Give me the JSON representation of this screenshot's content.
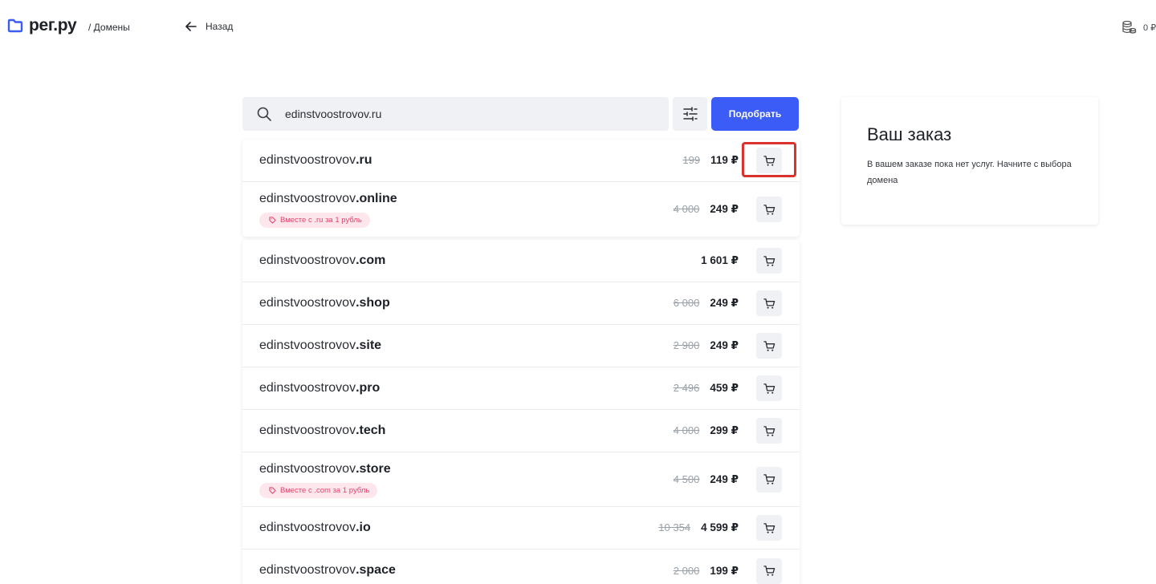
{
  "header": {
    "logo_text": "рег.ру",
    "section": "/ Домены",
    "back_label": "Назад",
    "balance": "0 ₽",
    "accent": "#3b5cf6"
  },
  "search": {
    "value": "edinstvoostrovov.ru",
    "placeholder": "",
    "submit_label": "Подобрать"
  },
  "icons": {
    "logo": "folder-icon",
    "back": "arrow-left-icon",
    "balance": "coins-icon",
    "search": "search-icon",
    "filter": "sliders-icon",
    "cart": "cart-icon",
    "promo": "tag-icon"
  },
  "domains": [
    {
      "name": "edinstvoostrovov",
      "tld": ".ru",
      "old_price": "199",
      "price": "119 ₽",
      "promo": ""
    },
    {
      "name": "edinstvoostrovov",
      "tld": ".online",
      "old_price": "4 000",
      "price": "249 ₽",
      "promo": "Вместе с .ru за 1 рубль"
    },
    {
      "name": "edinstvoostrovov",
      "tld": ".com",
      "old_price": "",
      "price": "1 601 ₽",
      "promo": ""
    },
    {
      "name": "edinstvoostrovov",
      "tld": ".shop",
      "old_price": "6 000",
      "price": "249 ₽",
      "promo": ""
    },
    {
      "name": "edinstvoostrovov",
      "tld": ".site",
      "old_price": "2 900",
      "price": "249 ₽",
      "promo": ""
    },
    {
      "name": "edinstvoostrovov",
      "tld": ".pro",
      "old_price": "2 496",
      "price": "459 ₽",
      "promo": ""
    },
    {
      "name": "edinstvoostrovov",
      "tld": ".tech",
      "old_price": "4 000",
      "price": "299 ₽",
      "promo": ""
    },
    {
      "name": "edinstvoostrovov",
      "tld": ".store",
      "old_price": "4 500",
      "price": "249 ₽",
      "promo": "Вместе с .com за 1 рубль"
    },
    {
      "name": "edinstvoostrovov",
      "tld": ".io",
      "old_price": "10 354",
      "price": "4 599 ₽",
      "promo": ""
    },
    {
      "name": "edinstvoostrovov",
      "tld": ".space",
      "old_price": "2 000",
      "price": "199 ₽",
      "promo": ""
    }
  ],
  "order": {
    "title": "Ваш заказ",
    "empty_text": "В вашем заказе пока нет услуг. Начните с выбора домена"
  }
}
